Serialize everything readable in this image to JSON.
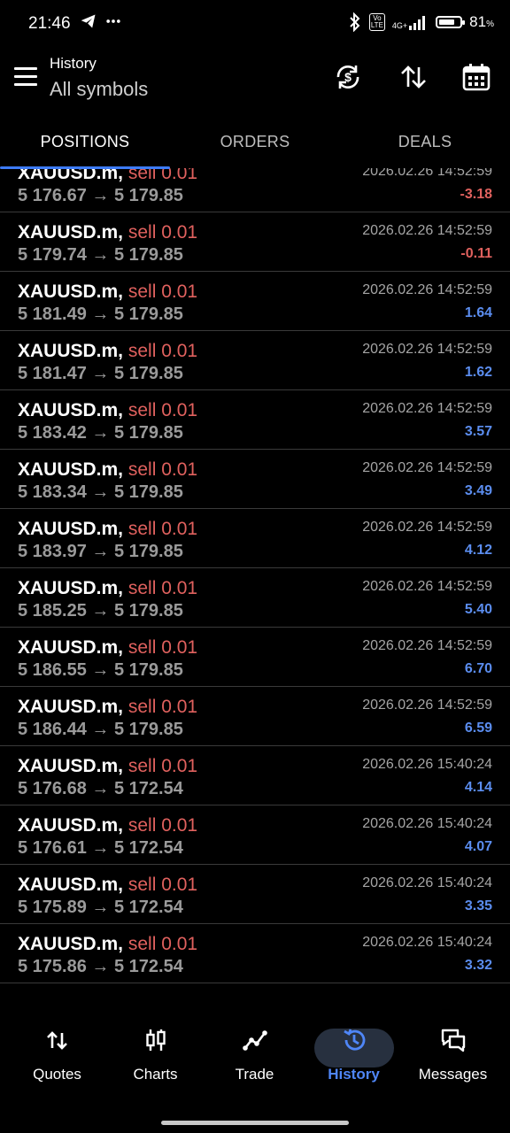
{
  "status_bar": {
    "time": "21:46",
    "left_icons": [
      "telegram-icon",
      "more-icon"
    ],
    "volte": "Vo\nLTE",
    "network": "4G+",
    "battery_percent_text": "81",
    "battery_unit": "%",
    "battery_level": 0.81
  },
  "header": {
    "title": "History",
    "subtitle": "All symbols",
    "icons": [
      "currency-exchange-icon",
      "sort-icon",
      "calendar-icon"
    ]
  },
  "tabs": [
    {
      "label": "POSITIONS",
      "active": true
    },
    {
      "label": "ORDERS",
      "active": false
    },
    {
      "label": "DEALS",
      "active": false
    }
  ],
  "positions": [
    {
      "symbol": "XAUUSD.m,",
      "type": "sell 0.01",
      "open_price": "5 176.67",
      "close_price": "5 179.85",
      "time": "2026.02.26 14:52:59",
      "profit": "-3.18",
      "positive": false
    },
    {
      "symbol": "XAUUSD.m,",
      "type": "sell 0.01",
      "open_price": "5 179.74",
      "close_price": "5 179.85",
      "time": "2026.02.26 14:52:59",
      "profit": "-0.11",
      "positive": false
    },
    {
      "symbol": "XAUUSD.m,",
      "type": "sell 0.01",
      "open_price": "5 181.49",
      "close_price": "5 179.85",
      "time": "2026.02.26 14:52:59",
      "profit": "1.64",
      "positive": true
    },
    {
      "symbol": "XAUUSD.m,",
      "type": "sell 0.01",
      "open_price": "5 181.47",
      "close_price": "5 179.85",
      "time": "2026.02.26 14:52:59",
      "profit": "1.62",
      "positive": true
    },
    {
      "symbol": "XAUUSD.m,",
      "type": "sell 0.01",
      "open_price": "5 183.42",
      "close_price": "5 179.85",
      "time": "2026.02.26 14:52:59",
      "profit": "3.57",
      "positive": true
    },
    {
      "symbol": "XAUUSD.m,",
      "type": "sell 0.01",
      "open_price": "5 183.34",
      "close_price": "5 179.85",
      "time": "2026.02.26 14:52:59",
      "profit": "3.49",
      "positive": true
    },
    {
      "symbol": "XAUUSD.m,",
      "type": "sell 0.01",
      "open_price": "5 183.97",
      "close_price": "5 179.85",
      "time": "2026.02.26 14:52:59",
      "profit": "4.12",
      "positive": true
    },
    {
      "symbol": "XAUUSD.m,",
      "type": "sell 0.01",
      "open_price": "5 185.25",
      "close_price": "5 179.85",
      "time": "2026.02.26 14:52:59",
      "profit": "5.40",
      "positive": true
    },
    {
      "symbol": "XAUUSD.m,",
      "type": "sell 0.01",
      "open_price": "5 186.55",
      "close_price": "5 179.85",
      "time": "2026.02.26 14:52:59",
      "profit": "6.70",
      "positive": true
    },
    {
      "symbol": "XAUUSD.m,",
      "type": "sell 0.01",
      "open_price": "5 186.44",
      "close_price": "5 179.85",
      "time": "2026.02.26 14:52:59",
      "profit": "6.59",
      "positive": true
    },
    {
      "symbol": "XAUUSD.m,",
      "type": "sell 0.01",
      "open_price": "5 176.68",
      "close_price": "5 172.54",
      "time": "2026.02.26 15:40:24",
      "profit": "4.14",
      "positive": true
    },
    {
      "symbol": "XAUUSD.m,",
      "type": "sell 0.01",
      "open_price": "5 176.61",
      "close_price": "5 172.54",
      "time": "2026.02.26 15:40:24",
      "profit": "4.07",
      "positive": true
    },
    {
      "symbol": "XAUUSD.m,",
      "type": "sell 0.01",
      "open_price": "5 175.89",
      "close_price": "5 172.54",
      "time": "2026.02.26 15:40:24",
      "profit": "3.35",
      "positive": true
    },
    {
      "symbol": "XAUUSD.m,",
      "type": "sell 0.01",
      "open_price": "5 175.86",
      "close_price": "5 172.54",
      "time": "2026.02.26 15:40:24",
      "profit": "3.32",
      "positive": true
    }
  ],
  "arrow": "→",
  "bottom_nav": [
    {
      "label": "Quotes",
      "icon": "quotes-icon",
      "active": false
    },
    {
      "label": "Charts",
      "icon": "charts-icon",
      "active": false
    },
    {
      "label": "Trade",
      "icon": "trade-icon",
      "active": false
    },
    {
      "label": "History",
      "icon": "history-icon",
      "active": true
    },
    {
      "label": "Messages",
      "icon": "messages-icon",
      "active": false
    }
  ],
  "colors": {
    "background": "#000000",
    "accent": "#4f86f7",
    "sell": "#e0615e",
    "profit_positive": "#5b8def",
    "profit_negative": "#e0615e",
    "tab_underline": "#3d7bf7"
  }
}
